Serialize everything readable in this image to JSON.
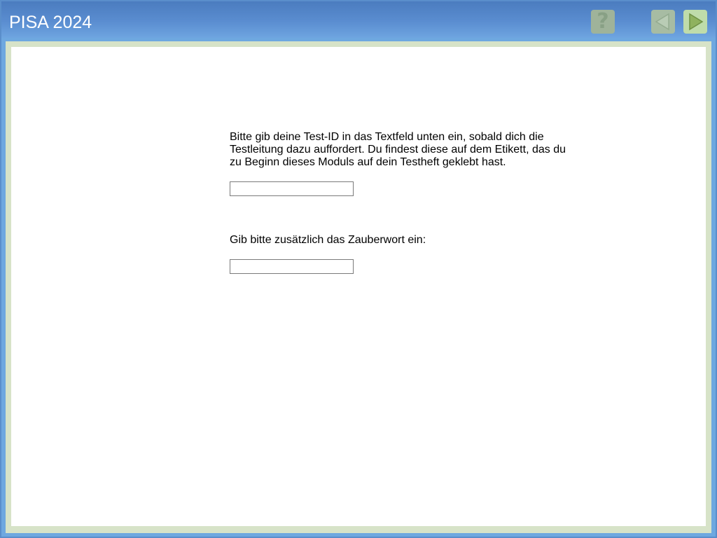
{
  "header": {
    "title": "PISA 2024",
    "help_button": {
      "icon": "question-mark-icon",
      "glyph": "?",
      "enabled": false
    },
    "back_button": {
      "icon": "triangle-left-icon",
      "enabled": false
    },
    "next_button": {
      "icon": "triangle-right-icon",
      "enabled": true
    }
  },
  "form": {
    "test_id_instruction": "Bitte gib deine Test-ID in das Textfeld unten ein, sobald dich die Testleitung dazu auffordert. Du findest diese auf dem Etikett, das du zu Beginn dieses Moduls auf dein Testheft geklebt hast.",
    "test_id_value": "",
    "magic_word_instruction": "Gib bitte zusätzlich das Zauberwort ein:",
    "magic_word_value": ""
  },
  "colors": {
    "header_top": "#4b7cbf",
    "header_bottom": "#6ea4e0",
    "content_border": "#d7e3c8",
    "content_background": "#ffffff",
    "disabled_button": "#a7bca3",
    "next_button": "#bfdcaa",
    "next_arrow": "#8fb25e"
  }
}
